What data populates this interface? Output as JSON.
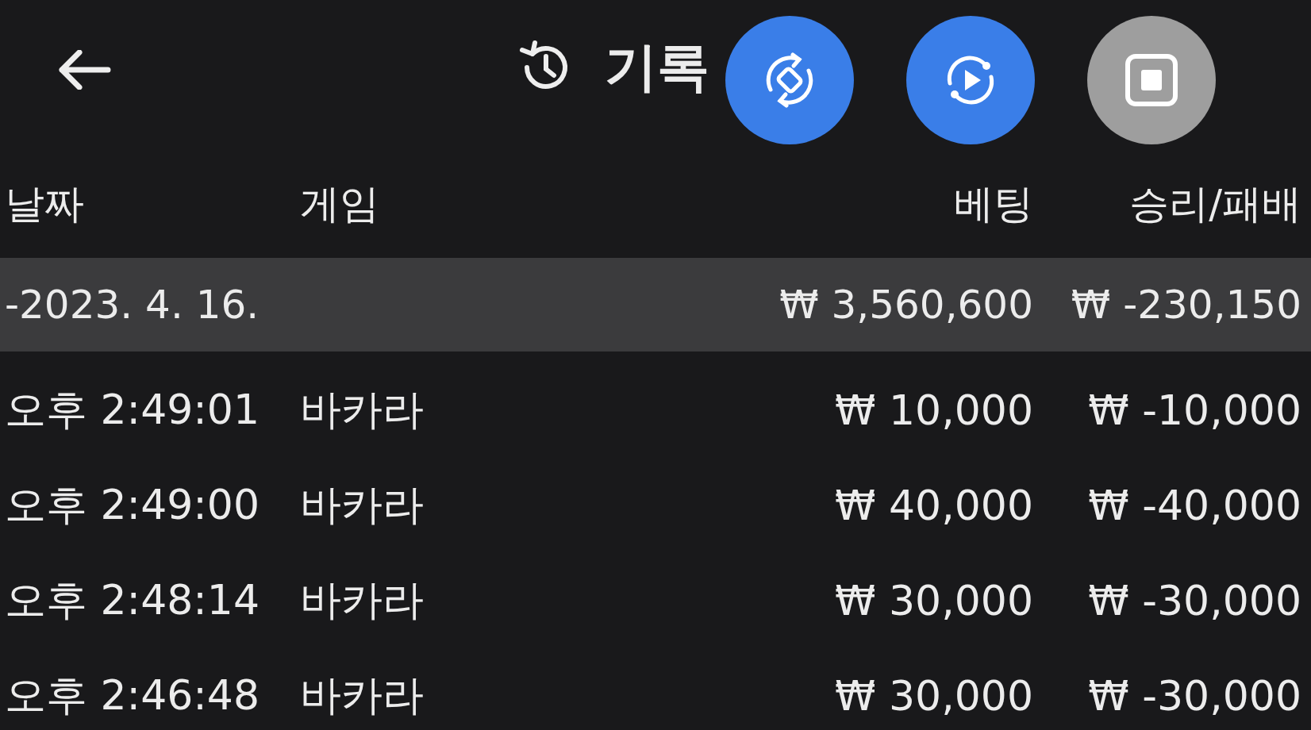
{
  "header": {
    "title": "기록",
    "buttons": [
      {
        "kind": "sync"
      },
      {
        "kind": "replay"
      },
      {
        "kind": "stop"
      }
    ]
  },
  "columns": [
    "날짜",
    "게임",
    "베팅",
    "승리/패배"
  ],
  "groups": [
    {
      "date": "-2023. 4. 16.",
      "bet": "₩ 3,560,600",
      "result": "₩ -230,150",
      "rows": [
        {
          "time": "오후 2:49:01",
          "game": "바카라",
          "bet": "₩ 10,000",
          "result": "₩ -10,000"
        },
        {
          "time": "오후 2:49:00",
          "game": "바카라",
          "bet": "₩ 40,000",
          "result": "₩ -40,000"
        },
        {
          "time": "오후 2:48:14",
          "game": "바카라",
          "bet": "₩ 30,000",
          "result": "₩ -30,000"
        },
        {
          "time": "오후 2:46:48",
          "game": "바카라",
          "bet": "₩ 30,000",
          "result": "₩ -30,000"
        }
      ]
    }
  ]
}
